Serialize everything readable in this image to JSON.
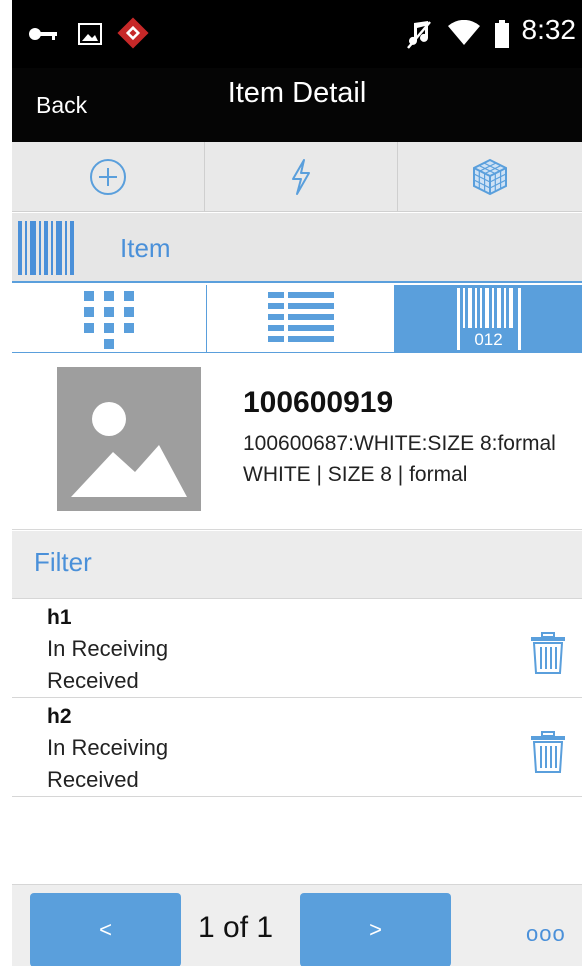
{
  "status_bar": {
    "time": "8:32",
    "icons": [
      "key-icon",
      "image-icon",
      "app-badge-icon",
      "mute-icon",
      "wifi-icon",
      "battery-icon"
    ]
  },
  "header": {
    "back_label": "Back",
    "title": "Item Detail"
  },
  "action_bar": {
    "icons": [
      "add-circle-icon",
      "lightning-icon",
      "cube-icon"
    ]
  },
  "item_section": {
    "label": "Item",
    "icon": "barcode-icon"
  },
  "view_tabs": {
    "icons": [
      "grid-view-icon",
      "list-view-icon",
      "barcode-view-icon"
    ],
    "barcode_text": "012",
    "active_index": 2
  },
  "item": {
    "id": "100600919",
    "description": "100600687:WHITE:SIZE 8:formal",
    "attributes": "WHITE | SIZE 8 | formal"
  },
  "filter": {
    "label": "Filter"
  },
  "list": [
    {
      "title": "h1",
      "line1": "In Receiving",
      "line2": "Received"
    },
    {
      "title": "h2",
      "line1": "In Receiving",
      "line2": "Received"
    }
  ],
  "footer": {
    "prev_label": "<",
    "page_text": "1 of 1",
    "next_label": ">",
    "more_label": "ooo"
  },
  "colors": {
    "accent": "#5a9fdc",
    "accent_text": "#4a90d9",
    "title_bar": "#050505",
    "thumbnail": "#9e9e9e"
  }
}
